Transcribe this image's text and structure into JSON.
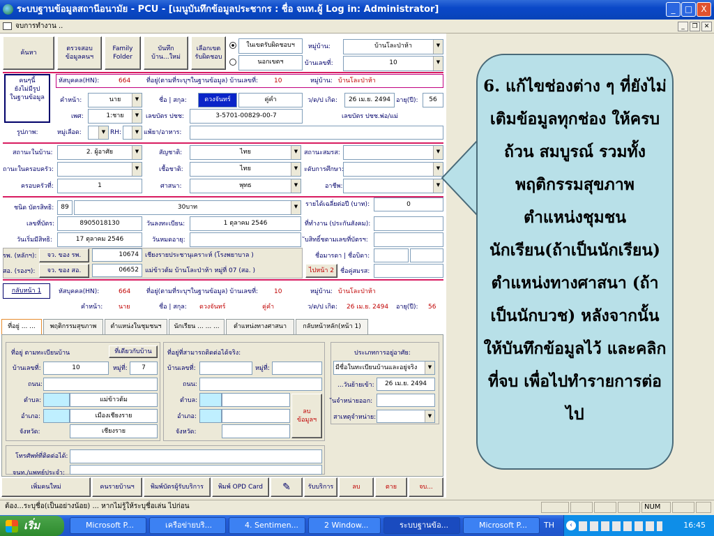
{
  "window": {
    "title": "ระบบฐานข้อมูลสถานีอนามัย - PCU - [เมนูบันทึกข้อมูลประชากร : ชื่อ จนท.ผู้ Log in: Administrator]",
    "min": "_",
    "max": "□",
    "close": "X"
  },
  "menubar": {
    "label": "จบการทำงาน .."
  },
  "toolbar": {
    "search": "ค้นหา",
    "check_line1": "ตรวจสอบ",
    "check_line2": "ข้อมูลคนฯ",
    "family_line1": "Family",
    "family_line2": "Folder",
    "save_line1": "บันทึก",
    "save_line2": "บ้าน...ใหม่",
    "area_line1": "เลือกเขต",
    "area_line2": "รับผิดชอบ",
    "radio_in": "ในเขตรับผิดชอบฯ",
    "radio_out": "นอกเขตฯ",
    "village_label": "หมู่บ้าน:",
    "village_value": "บ้านโละป่าห้า",
    "house_label": "บ้านเลขที่:",
    "house_value": "10"
  },
  "person": {
    "not_in_db_line1": "คนๆนี้",
    "not_in_db_line2": "ยังไม่มีรูป",
    "not_in_db_line3": "ในฐานข้อมูล",
    "hn_label": "หัสบุคคล(HN):",
    "hn_value": "664",
    "addr_label": "ที่อยู่(ตามที่ระบุฯในฐานข้อมูล) บ้านเลขที่:",
    "addr_value": "10",
    "moo_label": "หมู่บ้าน:",
    "moo_value": "บ้านโละป่าห้า",
    "prefix_label": "คำหน้า:",
    "prefix_value": "นาย",
    "name_label": "ชื่อ | สกุล:",
    "first_name": "ดวงจันทร์",
    "last_name": "คู่คำ",
    "dob_label": "ว/ด/ป เกิด:",
    "dob_value": "26 เม.ย. 2494",
    "age_label": "อายุ(ปี):",
    "age_value": "56",
    "sex_label": "เพศ:",
    "sex_value": "1:ชาย",
    "id_label": "เลขบัตร ปชช:",
    "id_value": "3-5701-00829-00-7",
    "parent_id_label": "เลขบัตร ปชช.พ่อ/แม่",
    "photo_label": "รูปภาพ:",
    "blood_label": "หมู่เลือด:",
    "rh_label": "RH:",
    "allergy_label": "แพ้ยา/อาหาร:"
  },
  "status": {
    "home_status_label": "สถานะในบ้าน:",
    "home_status_value": "2. ผู้อาศัย",
    "nationality_label": "สัญชาติ:",
    "nationality_value": "ไทย",
    "marital_label": "สถานะสมรส:",
    "family_status_label": "ถานะในครอบครัว:",
    "race_label": "เชื้อชาติ:",
    "race_value": "ไทย",
    "edu_label": "ะดับการศึกษา:",
    "family_no_label": "ครอบครัวที่:",
    "family_no_value": "1",
    "religion_label": "ศาสนา:",
    "religion_value": "พุทธ",
    "job_label": "อาชีพ:"
  },
  "rights": {
    "type_label": "ชนิด บัตรสิทธิ:",
    "type_code": "89",
    "type_value": "30บาท",
    "income_label": "รายได้เฉลี่ยต่อปี (บาท):",
    "income_value": "0",
    "card_no_label": "เลขที่บัตร:",
    "card_no_value": "8905018130",
    "reg_date_label": "วันลงทะเบียน:",
    "reg_date_value": "1 ตุลาคม 2546",
    "workplace_label": "ที่ทำงาน (ประกันสังคม):",
    "start_label": "วันเริ่มมีสิทธิ:",
    "start_value": "17 ตุลาคม 2546",
    "expire_label": "วันหมดอายุ:",
    "sub_label": "ับสิทธิ์ชตามเลขที่บัตรฯ:",
    "main_hosp_label": "รพ. (หลักฯ):",
    "main_hosp_btn": "จว. ของ รพ.",
    "main_hosp_code": "10674",
    "main_hosp_name": "เชียงรายประชานุเคราะห์ (โรงพยาบาล )",
    "alt_label": "สอ. (รองฯ):",
    "alt_btn": "จว. ของ สอ.",
    "alt_code": "06652",
    "alt_name": "แม่ข้าวต้ม บ้านโละป่าห้า หมู่ที่ 07 (สอ. )",
    "mother_father_label": "ชื่อมารดา | ชื่อบิดา:",
    "next_btn": "ไปหน้า 2",
    "spouse_label": "ชื่อคู่สมรส:"
  },
  "page2": {
    "back": "กลับหน้า 1",
    "hn_label": "หัสบุคคล(HN):",
    "hn_value": "664",
    "addr_label": "ที่อยู่(ตามที่ระบุฯในฐานข้อมูล) บ้านเลขที่:",
    "addr_value": "10",
    "moo_label": "หมู่บ้าน:",
    "moo_value": "บ้านโละป่าห้า",
    "prefix_label": "คำหน้า:",
    "prefix_value": "นาย",
    "name_label": "ชื่อ | สกุล:",
    "first_name": "ดวงจันทร์",
    "last_name": "คู่คำ",
    "dob_label": "ว/ด/ป เกิด:",
    "dob_value": "26 เม.ย. 2494",
    "age_label": "อายุ(ปี):",
    "age_value": "56"
  },
  "tabs": [
    "ที่อยู่ ... ...",
    "พฤติกรรมสุขภาพ",
    "ตำแหน่งในชุมชนฯ",
    "นักเรียน ... ... ...",
    "ตำแหน่งทางศาสนา",
    "กลับหน้าหลัก(หน้า 1)"
  ],
  "address": {
    "reg_title": "ที่อยู่ ตามทะเบียนบ้าน",
    "same_btn": "ที่เดียวกับบ้าน",
    "house_label": "บ้านเลขที่:",
    "house_value": "10",
    "moo_label": "หมู่ที่:",
    "moo_value": "7",
    "road_label": "ถนน:",
    "tambon_label": "ตำบล:",
    "tambon_value": "แม่ข้าวต้ม",
    "amphoe_label": "อำเภอ:",
    "amphoe_value": "เมืองเชียงราย",
    "province_label": "จังหวัด:",
    "province_value": "เชียงราย",
    "contact_title": "ที่อยู่ที่สามารถติดต่อได้จริง:",
    "c_house_label": "บ้านเลขที่:",
    "c_moo_label": "หมู่ที่:",
    "c_road_label": "ถนน:",
    "c_tambon_label": "ตำบล:",
    "c_amphoe_label": "อำเภอ:",
    "c_province_label": "จังหวัด:",
    "delete_line1": "ลบ",
    "delete_line2": "ข้อมูลฯ",
    "residence_title": "ประเภทการอยู่อาศัย:",
    "residence_value": "มีชื่อในทะเบียนบ้านและอยู่จริง",
    "move_in_label": "...วันย้ายเข้า:",
    "move_in_value": "26 เม.ย. 2494",
    "disch_label": "ันจำหน่ายออก:",
    "disch_reason_label": "สาเหตุจำหน่าย:",
    "phone_label": "โทรศัพท์ที่ติดต่อได้:",
    "contact_person_label": "จนท./แพทย์ประจำ:"
  },
  "bottom": {
    "add_person": "เพิ่มคนใหม่",
    "house_list": "คนรายบ้านฯ",
    "print_card": "พิมพ์บัตรผู้รับบริการ",
    "print_opd": "พิมพ์ OPD Card",
    "service": "รับบริการ",
    "delete": "ลบ",
    "death": "ตาย",
    "end": "จบ..."
  },
  "callout": {
    "text": "6. แก้ไขช่องต่าง ๆ ที่ยังไม่เติมข้อมูลทุกช่อง ให้ครบถ้วน สมบูรณ์ รวมทั้ง พฤติกรรมสุขภาพ ตำแหน่งชุมชน นักเรียน(ถ้าเป็นนักเรียน) ตำแหน่งทางศาสนา (ถ้าเป็นนักบวช) หลังจากนั้นให้บันทึกข้อมูลไว้ และคลิกที่จบ เพื่อไปทำรายการต่อไป"
  },
  "statusbar": {
    "message": "ต้อง...ระบุชื่อ(เป็นอย่างน้อย) ... หากไม่รู้ให้ระบุชื่อเล่น ไปก่อน",
    "num": "NUM"
  },
  "taskbar": {
    "start": "เริ่ม",
    "tasks": [
      "Microsoft P...",
      "เครือข่ายบริ...",
      "4. Sentimen...",
      "2 Window...",
      "ระบบฐานข้อ...",
      "Microsoft P..."
    ],
    "lang": "TH",
    "clock": "16:45"
  }
}
